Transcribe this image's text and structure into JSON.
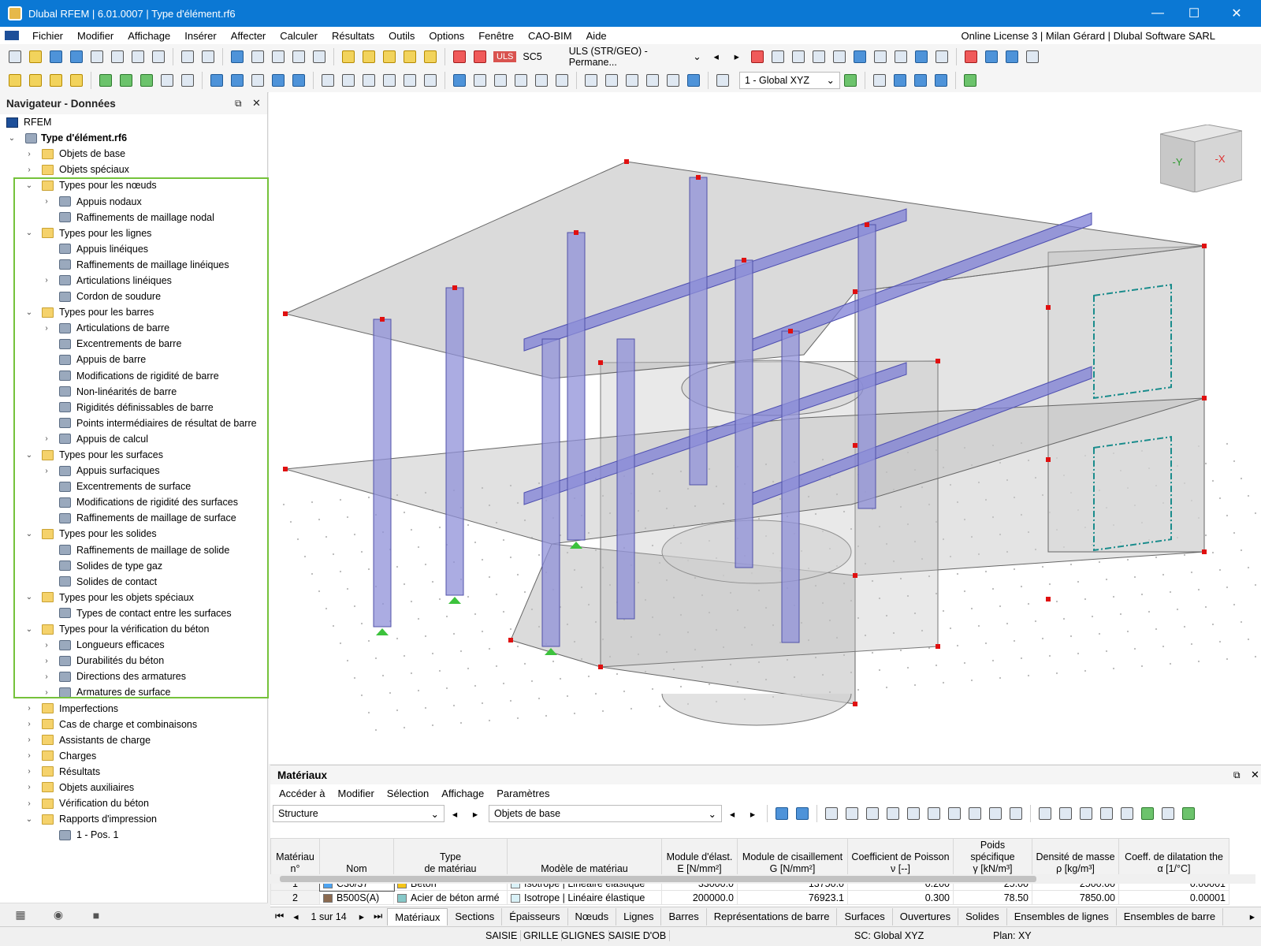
{
  "titlebar": {
    "title": "Dlubal RFEM | 6.01.0007 | Type d'élément.rf6",
    "min": "—",
    "max": "☐",
    "close": "✕"
  },
  "menu": {
    "items": [
      "Fichier",
      "Modifier",
      "Affichage",
      "Insérer",
      "Affecter",
      "Calculer",
      "Résultats",
      "Outils",
      "Options",
      "Fenêtre",
      "CAO-BIM",
      "Aide"
    ],
    "license": "Online License 3 | Milan Gérard | Dlubal Software SARL"
  },
  "toolbar": {
    "uls_badge": "ULS",
    "case": "SC5",
    "combo": "ULS (STR/GEO) - Permane...",
    "view_combo": "1 - Global XYZ"
  },
  "navigator": {
    "title": "Navigateur - Données",
    "root": "RFEM",
    "file": "Type d'élément.rf6",
    "items": [
      {
        "label": "Objets de base",
        "level": 1,
        "exp": "›",
        "icon": "folder"
      },
      {
        "label": "Objets spéciaux",
        "level": 1,
        "exp": "›",
        "icon": "folder"
      },
      {
        "label": "Types pour les nœuds",
        "level": 1,
        "exp": "⌄",
        "icon": "folder"
      },
      {
        "label": "Appuis nodaux",
        "level": 2,
        "exp": "›",
        "icon": "item"
      },
      {
        "label": "Raffinements de maillage nodal",
        "level": 2,
        "exp": "",
        "icon": "item"
      },
      {
        "label": "Types pour les lignes",
        "level": 1,
        "exp": "⌄",
        "icon": "folder"
      },
      {
        "label": "Appuis linéiques",
        "level": 2,
        "exp": "",
        "icon": "item"
      },
      {
        "label": "Raffinements de maillage linéiques",
        "level": 2,
        "exp": "",
        "icon": "item"
      },
      {
        "label": "Articulations linéiques",
        "level": 2,
        "exp": "›",
        "icon": "item"
      },
      {
        "label": "Cordon de soudure",
        "level": 2,
        "exp": "",
        "icon": "item"
      },
      {
        "label": "Types pour les barres",
        "level": 1,
        "exp": "⌄",
        "icon": "folder"
      },
      {
        "label": "Articulations de barre",
        "level": 2,
        "exp": "›",
        "icon": "item"
      },
      {
        "label": "Excentrements de barre",
        "level": 2,
        "exp": "",
        "icon": "item"
      },
      {
        "label": "Appuis de barre",
        "level": 2,
        "exp": "",
        "icon": "item"
      },
      {
        "label": "Modifications de rigidité de barre",
        "level": 2,
        "exp": "",
        "icon": "item"
      },
      {
        "label": "Non-linéarités de barre",
        "level": 2,
        "exp": "",
        "icon": "item"
      },
      {
        "label": "Rigidités définissables de barre",
        "level": 2,
        "exp": "",
        "icon": "item"
      },
      {
        "label": "Points intermédiaires de résultat de barre",
        "level": 2,
        "exp": "",
        "icon": "item"
      },
      {
        "label": "Appuis de calcul",
        "level": 2,
        "exp": "›",
        "icon": "item"
      },
      {
        "label": "Types pour les surfaces",
        "level": 1,
        "exp": "⌄",
        "icon": "folder"
      },
      {
        "label": "Appuis surfaciques",
        "level": 2,
        "exp": "›",
        "icon": "item"
      },
      {
        "label": "Excentrements de surface",
        "level": 2,
        "exp": "",
        "icon": "item"
      },
      {
        "label": "Modifications de rigidité des surfaces",
        "level": 2,
        "exp": "",
        "icon": "item"
      },
      {
        "label": "Raffinements de maillage de surface",
        "level": 2,
        "exp": "",
        "icon": "item"
      },
      {
        "label": "Types pour les solides",
        "level": 1,
        "exp": "⌄",
        "icon": "folder"
      },
      {
        "label": "Raffinements de maillage de solide",
        "level": 2,
        "exp": "",
        "icon": "item"
      },
      {
        "label": "Solides de type gaz",
        "level": 2,
        "exp": "",
        "icon": "item"
      },
      {
        "label": "Solides de contact",
        "level": 2,
        "exp": "",
        "icon": "item"
      },
      {
        "label": "Types pour les objets spéciaux",
        "level": 1,
        "exp": "⌄",
        "icon": "folder"
      },
      {
        "label": "Types de contact entre les surfaces",
        "level": 2,
        "exp": "",
        "icon": "item"
      },
      {
        "label": "Types pour la vérification du béton",
        "level": 1,
        "exp": "⌄",
        "icon": "folder"
      },
      {
        "label": "Longueurs efficaces",
        "level": 2,
        "exp": "›",
        "icon": "item"
      },
      {
        "label": "Durabilités du béton",
        "level": 2,
        "exp": "›",
        "icon": "item"
      },
      {
        "label": "Directions des armatures",
        "level": 2,
        "exp": "›",
        "icon": "item"
      },
      {
        "label": "Armatures de surface",
        "level": 2,
        "exp": "›",
        "icon": "item"
      },
      {
        "label": "Imperfections",
        "level": 1,
        "exp": "›",
        "icon": "folder"
      },
      {
        "label": "Cas de charge et combinaisons",
        "level": 1,
        "exp": "›",
        "icon": "folder"
      },
      {
        "label": "Assistants de charge",
        "level": 1,
        "exp": "›",
        "icon": "folder"
      },
      {
        "label": "Charges",
        "level": 1,
        "exp": "›",
        "icon": "folder"
      },
      {
        "label": "Résultats",
        "level": 1,
        "exp": "›",
        "icon": "folder"
      },
      {
        "label": "Objets auxiliaires",
        "level": 1,
        "exp": "›",
        "icon": "folder"
      },
      {
        "label": "Vérification du béton",
        "level": 1,
        "exp": "›",
        "icon": "folder"
      },
      {
        "label": "Rapports d'impression",
        "level": 1,
        "exp": "⌄",
        "icon": "folder"
      },
      {
        "label": "1 - Pos. 1",
        "level": 2,
        "exp": "",
        "icon": "item"
      }
    ]
  },
  "viewcube": {
    "front": "-Y",
    "side": "-X"
  },
  "materials": {
    "title": "Matériaux",
    "menu": [
      "Accéder à",
      "Modifier",
      "Sélection",
      "Affichage",
      "Paramètres"
    ],
    "combo1": "Structure",
    "combo2": "Objets de base",
    "headers": [
      {
        "l1": "Matériau",
        "l2": "n°"
      },
      {
        "l1": "",
        "l2": "Nom"
      },
      {
        "l1": "Type",
        "l2": "de matériau"
      },
      {
        "l1": "",
        "l2": "Modèle de matériau"
      },
      {
        "l1": "Module d'élast.",
        "l2": "E [N/mm²]"
      },
      {
        "l1": "Module de cisaillement",
        "l2": "G [N/mm²]"
      },
      {
        "l1": "Coefficient de Poisson",
        "l2": "ν [--]"
      },
      {
        "l1": "Poids spécifique",
        "l2": "γ [kN/m³]"
      },
      {
        "l1": "Densité de masse",
        "l2": "ρ [kg/m³]"
      },
      {
        "l1": "Coeff. de dilatation the",
        "l2": "α [1/°C]"
      }
    ],
    "rows": [
      {
        "no": "1",
        "name": "C30/37",
        "name_color": "#4da3f0",
        "type": "Béton",
        "type_color": "#f5c518",
        "model": "Isotrope | Linéaire élastique",
        "model_color": "#d9f1f7",
        "E": "33000.0",
        "G": "13750.0",
        "nu": "0.200",
        "gamma": "25.00",
        "rho": "2500.00",
        "alpha": "0.00001"
      },
      {
        "no": "2",
        "name": "B500S(A)",
        "name_color": "#8b6a50",
        "type": "Acier de béton armé",
        "type_color": "#86c8c8",
        "model": "Isotrope | Linéaire élastique",
        "model_color": "#d9f1f7",
        "E": "200000.0",
        "G": "76923.1",
        "nu": "0.300",
        "gamma": "78.50",
        "rho": "7850.00",
        "alpha": "0.00001"
      }
    ],
    "pager": "1 sur 14",
    "tabs": [
      "Matériaux",
      "Sections",
      "Épaisseurs",
      "Nœuds",
      "Lignes",
      "Barres",
      "Représentations de barre",
      "Surfaces",
      "Ouvertures",
      "Solides",
      "Ensembles de lignes",
      "Ensembles de barre"
    ]
  },
  "status": {
    "items": [
      "SAISIE",
      "GRILLE",
      "GLIGNES",
      "SAISIE D'OB"
    ],
    "sc": "SC: Global XYZ",
    "plan": "Plan: XY"
  }
}
